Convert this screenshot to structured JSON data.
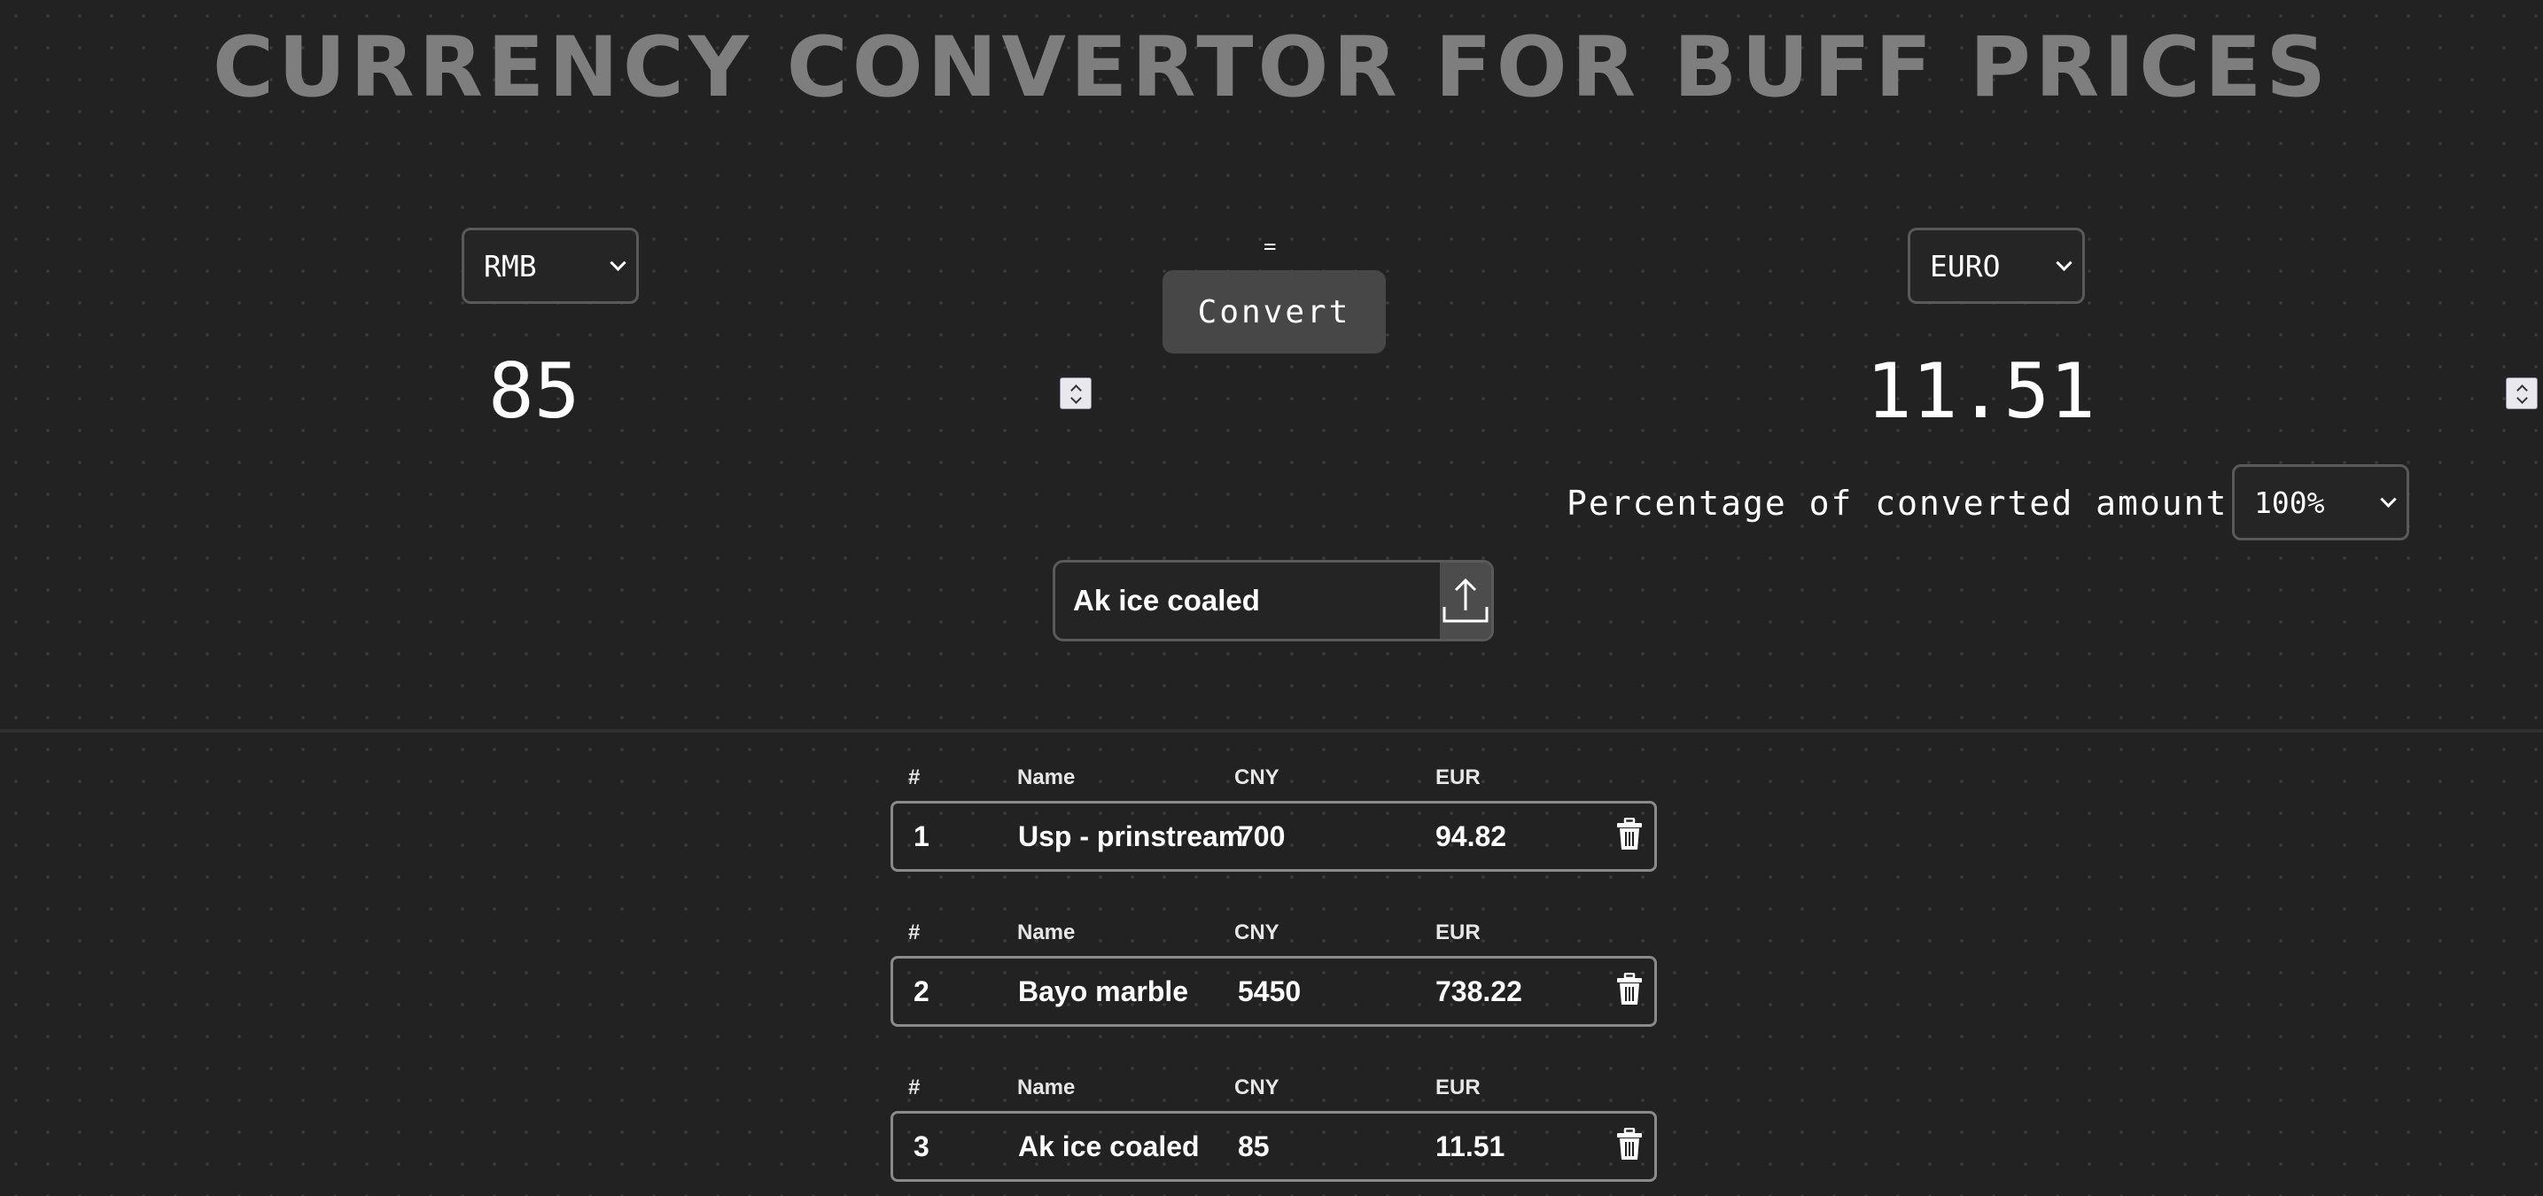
{
  "header": {
    "title": "CURRENCY CONVERTOR FOR BUFF PRICES"
  },
  "converter": {
    "from_currency": "RMB",
    "to_currency": "EURO",
    "from_amount": "85",
    "to_amount": "11.51",
    "equals": "=",
    "convert_label": "Convert",
    "percentage_label": "Percentage of converted amount :",
    "percentage_value": "100%"
  },
  "item_entry": {
    "value": "Ak ice coaled",
    "upload_icon": "upload-arrow-icon"
  },
  "table": {
    "headers": {
      "num": "#",
      "name": "Name",
      "cny": "CNY",
      "eur": "EUR"
    },
    "rows": [
      {
        "num": "1",
        "name": "Usp - prinstream",
        "cny": "700",
        "eur": "94.82"
      },
      {
        "num": "2",
        "name": "Bayo marble",
        "cny": "5450",
        "eur": "738.22"
      },
      {
        "num": "3",
        "name": "Ak ice coaled",
        "cny": "85",
        "eur": "11.51"
      }
    ],
    "delete_icon": "trash-icon"
  },
  "colors": {
    "background": "#222222",
    "title": "#7e7e7e",
    "button": "#474747",
    "border": "#8a8a8a"
  }
}
